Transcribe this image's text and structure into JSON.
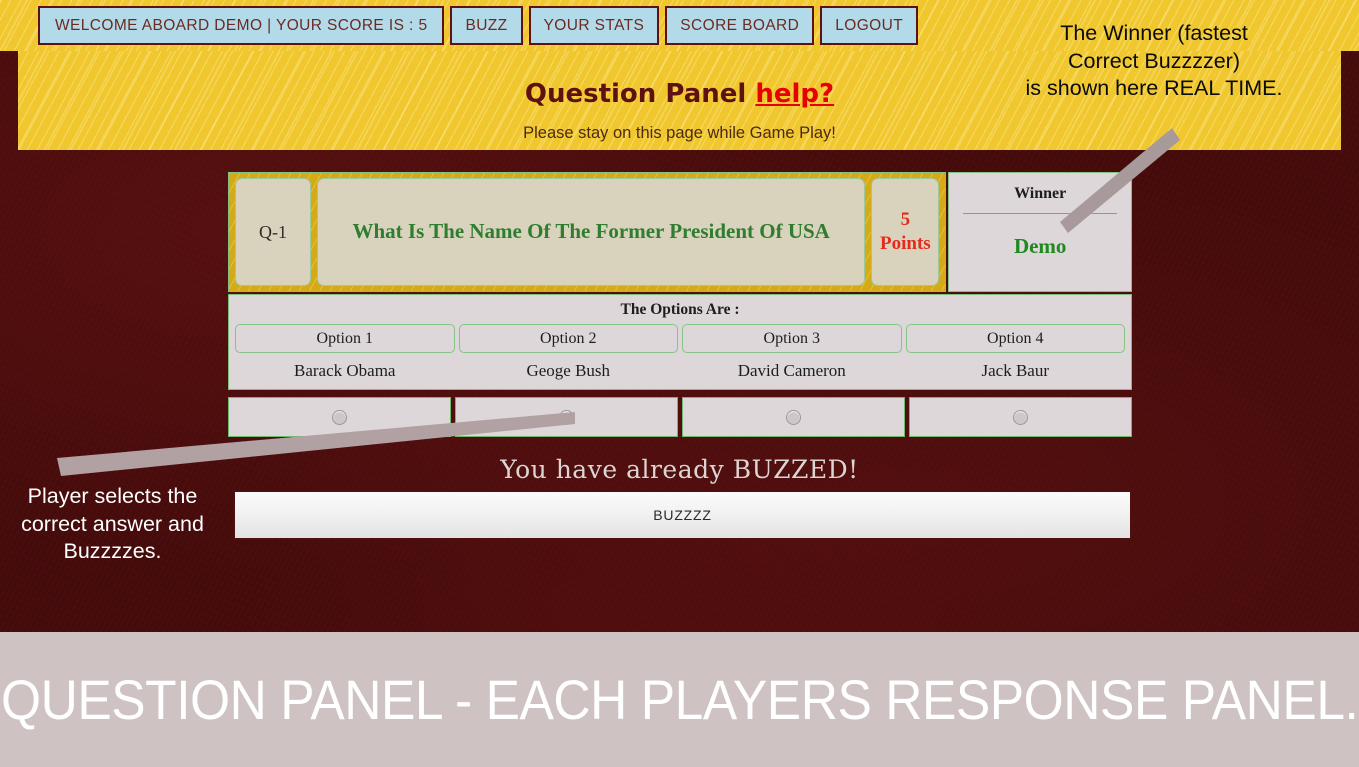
{
  "navbar": {
    "welcome": "WELCOME ABOARD DEMO | YOUR SCORE IS : 5",
    "buttons": [
      {
        "label": "BUZZ",
        "name": "nav-buzz"
      },
      {
        "label": "YOUR STATS",
        "name": "nav-your-stats"
      },
      {
        "label": "SCORE BOARD",
        "name": "nav-score-board"
      },
      {
        "label": "LOGOUT",
        "name": "nav-logout"
      }
    ]
  },
  "header": {
    "title": "Question Panel",
    "help_link": "help?",
    "subtitle": "Please stay on this page while Game Play!"
  },
  "question": {
    "number": "Q-1",
    "text": "What Is The Name Of The Former President Of USA",
    "points": "5\nPoints",
    "points_value": "5",
    "points_label": "Points"
  },
  "winner": {
    "label": "Winner",
    "name": "Demo"
  },
  "options": {
    "heading": "The Options Are :",
    "boxes": [
      "Option 1",
      "Option 2",
      "Option 3",
      "Option 4"
    ],
    "answers": [
      "Barack Obama",
      "Geoge Bush",
      "David Cameron",
      "Jack Baur"
    ],
    "selected_index": 1
  },
  "buzz": {
    "status_message": "You have already BUZZED!",
    "button_label": "BUZZZZ"
  },
  "annotations": {
    "winner_note": "The Winner (fastest Correct Buzzzzer) is shown here REAL TIME.",
    "winner_note_line1": "The Winner (fastest",
    "winner_note_line2": "Correct Buzzzzer)",
    "winner_note_line3": "is shown here REAL TIME.",
    "player_note_line1": "Player selects the",
    "player_note_line2": "correct answer and",
    "player_note_line3": "Buzzzzes."
  },
  "caption": {
    "text": "QUESTION PANEL - EACH PLAYERS RESPONSE PANEL."
  },
  "colors": {
    "gold": "#f0c72e",
    "maroon": "#430b0b",
    "nav_button": "#b2dae8",
    "green_text": "#2f7d2f",
    "red_points": "#e42b1c",
    "help_red": "#e60000",
    "caption_bar": "#cec2c2"
  }
}
